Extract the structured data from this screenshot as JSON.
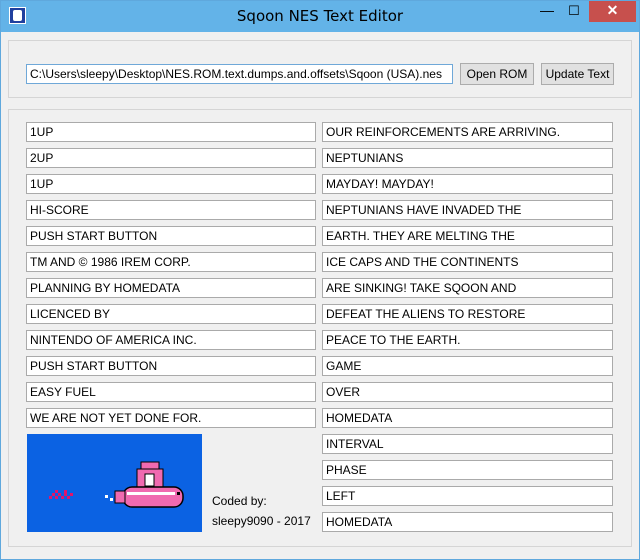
{
  "window": {
    "title": "Sqoon NES Text Editor"
  },
  "titlebar": {
    "minimize_icon": "minimize-icon",
    "maximize_icon": "maximize-icon",
    "close_icon": "close-icon"
  },
  "file": {
    "path": "C:\\Users\\sleepy\\Desktop\\NES.ROM.text.dumps.and.offsets\\Sqoon (USA).nes",
    "open_label": "Open ROM",
    "update_label": "Update Text"
  },
  "left_fields": [
    "1UP",
    "2UP",
    "1UP",
    "HI-SCORE",
    "PUSH START BUTTON",
    "TM AND © 1986 IREM CORP.",
    "PLANNING BY HOMEDATA",
    "LICENCED BY",
    "NINTENDO OF AMERICA INC.",
    "PUSH START BUTTON",
    "EASY FUEL",
    "WE ARE NOT YET DONE FOR."
  ],
  "right_fields": [
    "OUR REINFORCEMENTS ARE ARRIVING.",
    "NEPTUNIANS",
    "MAYDAY! MAYDAY!",
    "NEPTUNIANS HAVE INVADED THE",
    "EARTH. THEY ARE MELTING THE",
    "ICE CAPS AND THE CONTINENTS",
    "ARE SINKING! TAKE SQOON AND",
    "DEFEAT THE ALIENS TO RESTORE",
    "PEACE TO THE EARTH.",
    "GAME",
    "OVER",
    "HOMEDATA",
    "INTERVAL",
    "PHASE",
    "LEFT",
    "HOMEDATA"
  ],
  "credits": {
    "line1": "Coded by:",
    "line2": "sleepy9090 - 2017"
  },
  "colors": {
    "titlebar": "#63b3e8",
    "close": "#c7504d",
    "preview_bg": "#0b62e3",
    "submarine": "#f06ab0",
    "fish": "#e0156b"
  }
}
